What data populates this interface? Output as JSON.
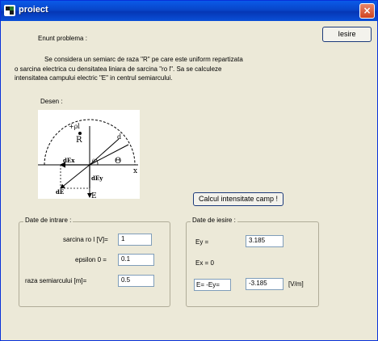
{
  "window": {
    "title": "proiect",
    "close_glyph": "×"
  },
  "buttons": {
    "exit": "Iesire",
    "calc": "Calcul intensitate camp !"
  },
  "problem": {
    "heading": "Enunt problema :",
    "lines": [
      "Se considera un semiarc de raza \"R\" pe care este uniform repartizata",
      "o sarcina electrica cu densitatea liniara de sarcina \"ro l\".    Sa se calculeze",
      "intensitatea campului electric \"E\" in centrul semiarcului."
    ]
  },
  "drawing": {
    "label": "Desen :",
    "labels": {
      "q": "+ρl",
      "R": "R",
      "d": "d",
      "theta1": "θ",
      "theta2": "Θ",
      "x": "x",
      "dEx": "dEx",
      "dEy": "dEy",
      "dE": "dE",
      "E": "E"
    }
  },
  "inputs": {
    "title": "Date de intrare :",
    "fields": [
      {
        "label": "sarcina ro l [V]=",
        "value": "1"
      },
      {
        "label": "epsilon 0 =",
        "value": "0.1"
      },
      {
        "label": "raza semiarcului [m]=",
        "value": "0.5"
      }
    ]
  },
  "outputs": {
    "title": "Date de iesire :",
    "ey_label": "Ey =",
    "ey_value": "3.185",
    "ex_label": "Ex = 0",
    "e_label": "E= -Ey=",
    "e_value": "-3.185",
    "e_unit": "[V/m]"
  }
}
